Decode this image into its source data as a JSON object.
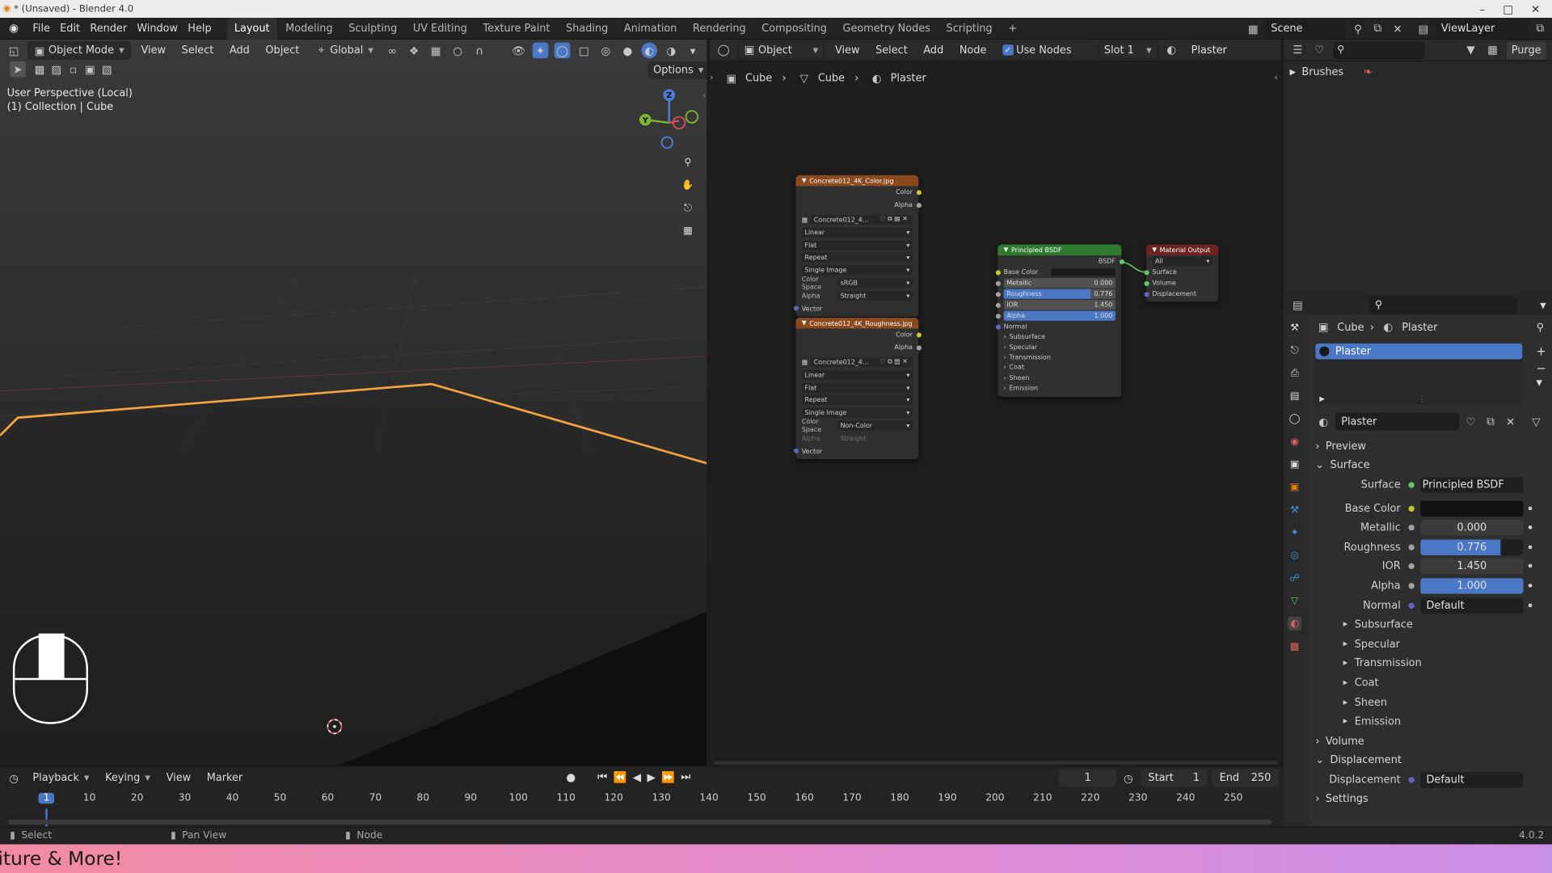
{
  "titlebar": {
    "title": "* (Unsaved) - Blender 4.0"
  },
  "menu": {
    "items": [
      "File",
      "Edit",
      "Render",
      "Window",
      "Help"
    ]
  },
  "workspaces": [
    "Layout",
    "Modeling",
    "Sculpting",
    "UV Editing",
    "Texture Paint",
    "Shading",
    "Animation",
    "Rendering",
    "Compositing",
    "Geometry Nodes",
    "Scripting"
  ],
  "active_workspace": "Layout",
  "scene": {
    "label": "Scene",
    "viewlayer": "ViewLayer"
  },
  "viewport": {
    "mode": "Object Mode",
    "menus": [
      "View",
      "Select",
      "Add",
      "Object"
    ],
    "orientation": "Global",
    "options": "Options",
    "info_line1": "User Perspective (Local)",
    "info_line2": "(1) Collection | Cube",
    "gizmo": {
      "z": "Z",
      "y": "Y",
      "x": "X"
    }
  },
  "node_editor": {
    "type": "Object",
    "menus": [
      "View",
      "Select",
      "Add",
      "Node"
    ],
    "use_nodes": "Use Nodes",
    "slot": "Slot 1",
    "material": "Plaster",
    "breadcrumb": [
      "Cube",
      "Cube",
      "Plaster"
    ],
    "tex_color": {
      "title": "Concrete012_4K_Color.jpg",
      "out_color": "Color",
      "out_alpha": "Alpha",
      "image": "Concrete012_4...",
      "interp": "Linear",
      "proj": "Flat",
      "ext": "Repeat",
      "source": "Single Image",
      "cs_label": "Color Space",
      "cs_value": "sRGB",
      "alpha_label": "Alpha",
      "alpha_value": "Straight",
      "vector": "Vector"
    },
    "tex_rough": {
      "title": "Concrete012_4K_Roughness.jpg",
      "out_color": "Color",
      "out_alpha": "Alpha",
      "image": "Concrete012_4...",
      "interp": "Linear",
      "proj": "Flat",
      "ext": "Repeat",
      "source": "Single Image",
      "cs_label": "Color Space",
      "cs_value": "Non-Color",
      "alpha_label": "Alpha",
      "alpha_value": "Straight",
      "vector": "Vector"
    },
    "bsdf": {
      "title": "Principled BSDF",
      "out": "BSDF",
      "base_color": "Base Color",
      "metallic": "Metallic",
      "metallic_v": "0.000",
      "roughness": "Roughness",
      "roughness_v": "0.776",
      "ior": "IOR",
      "ior_v": "1.450",
      "alpha": "Alpha",
      "alpha_v": "1.000",
      "normal": "Normal",
      "panels": [
        "Subsurface",
        "Specular",
        "Transmission",
        "Coat",
        "Sheen",
        "Emission"
      ]
    },
    "output": {
      "title": "Material Output",
      "target": "All",
      "surface": "Surface",
      "volume": "Volume",
      "displacement": "Displacement"
    }
  },
  "outliner": {
    "item": "Brushes"
  },
  "properties": {
    "breadcrumb": [
      "Cube",
      "Plaster"
    ],
    "slot": "Plaster",
    "material": "Plaster",
    "sections": {
      "preview": "Preview",
      "surface": "Surface",
      "volume": "Volume",
      "displacement": "Displacement",
      "settings": "Settings"
    },
    "surface_label": "Surface",
    "surface_value": "Principled BSDF",
    "rows": [
      {
        "label": "Base Color",
        "value": "",
        "kind": "color",
        "dot": "#c7c729"
      },
      {
        "label": "Metallic",
        "value": "0.000",
        "kind": "num",
        "fill": 0,
        "dot": "#a1a1a1"
      },
      {
        "label": "Roughness",
        "value": "0.776",
        "kind": "num",
        "fill": 0.776,
        "dot": "#a1a1a1"
      },
      {
        "label": "IOR",
        "value": "1.450",
        "kind": "num",
        "fill": 0,
        "dot": "#a1a1a1"
      },
      {
        "label": "Alpha",
        "value": "1.000",
        "kind": "num",
        "fill": 1,
        "dot": "#a1a1a1"
      },
      {
        "label": "Normal",
        "value": "Default",
        "kind": "link",
        "dot": "#6363c7"
      }
    ],
    "panels": [
      "Subsurface",
      "Specular",
      "Transmission",
      "Coat",
      "Sheen",
      "Emission"
    ],
    "disp_label": "Displacement",
    "disp_value": "Default"
  },
  "timeline": {
    "menus": [
      "Playback",
      "Keying",
      "View",
      "Marker"
    ],
    "current": "1",
    "start_label": "Start",
    "start": "1",
    "end_label": "End",
    "end": "250",
    "ticks": [
      "1",
      "10",
      "20",
      "30",
      "40",
      "50",
      "60",
      "70",
      "80",
      "90",
      "100",
      "110",
      "120",
      "130",
      "140",
      "150",
      "160",
      "170",
      "180",
      "190",
      "200",
      "210",
      "220",
      "230",
      "240",
      "250"
    ]
  },
  "status": {
    "select": "Select",
    "pan": "Pan View",
    "node": "Node",
    "version": "4.0.2"
  },
  "banner": {
    "text": "iture & More!"
  },
  "colors": {
    "accent": "#4b78c6",
    "selection": "#f5a341",
    "texture_header": "#8a4a1e",
    "bsdf_header": "#2f7a2f",
    "output_header": "#6e2323"
  }
}
